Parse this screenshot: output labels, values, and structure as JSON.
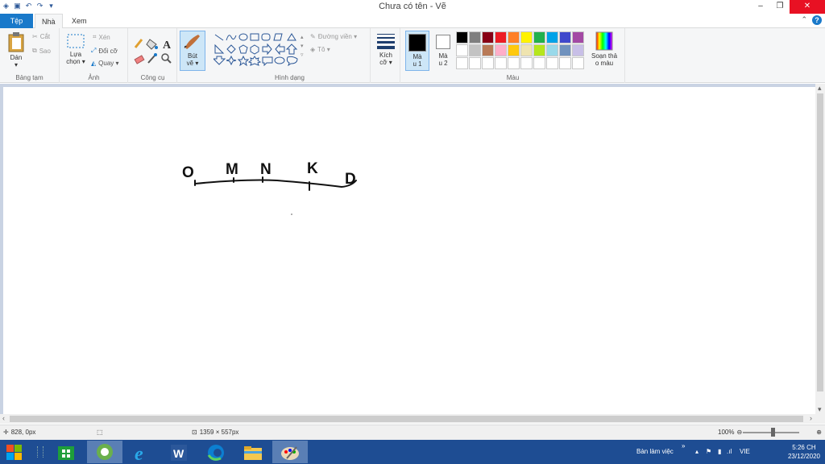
{
  "window": {
    "title": "Chưa có tên - Vẽ"
  },
  "tabs": {
    "file": "Tệp",
    "home": "Nhà",
    "view": "Xem"
  },
  "ribbon": {
    "clipboard": {
      "paste": "Dán",
      "cut": "Cắt",
      "copy": "Sao",
      "group": "Bảng tạm"
    },
    "image": {
      "select_line1": "Lựa",
      "select_line2": "chọn ▾",
      "crop": "Xén",
      "resize": "Đổi cỡ",
      "rotate": "Quay ▾",
      "group": "Ảnh"
    },
    "tools": {
      "group": "Công cụ"
    },
    "brush": {
      "line1": "Bút",
      "line2": "vẽ ▾"
    },
    "shapes": {
      "outline": "Đường viền ▾",
      "fill": "Tô ▾",
      "group": "Hình dạng"
    },
    "size": {
      "line1": "Kích",
      "line2": "cỡ ▾"
    },
    "colors": {
      "color1_line1": "Mà",
      "color1_line2": "u 1",
      "color2_line1": "Mà",
      "color2_line2": "u 2",
      "edit_line1": "Soạn thả",
      "edit_line2": "o màu",
      "group": "Màu",
      "color1": "#000000",
      "color2": "#ffffff",
      "swatches": [
        "#000000",
        "#7f7f7f",
        "#880015",
        "#ed1c24",
        "#ff7f27",
        "#fff200",
        "#22b14c",
        "#00a2e8",
        "#3f48cc",
        "#a349a4",
        "#ffffff",
        "#c3c3c3",
        "#b97a57",
        "#ffaec9",
        "#ffc90e",
        "#efe4b0",
        "#b5e61d",
        "#99d9ea",
        "#7092be",
        "#c8bfe7",
        "#ffffff",
        "#ffffff",
        "#ffffff",
        "#ffffff",
        "#ffffff",
        "#ffffff",
        "#ffffff",
        "#ffffff",
        "#ffffff",
        "#ffffff"
      ]
    }
  },
  "drawing": {
    "labels": [
      "O",
      "M",
      "N",
      "K",
      "D"
    ]
  },
  "status": {
    "cursor": "828, 0px",
    "canvas_size": "1359 × 557px",
    "zoom": "100%"
  },
  "taskbar": {
    "desktop": "Bàn làm việc",
    "lang": "VIE",
    "time": "5:26 CH",
    "date": "23/12/2020"
  }
}
